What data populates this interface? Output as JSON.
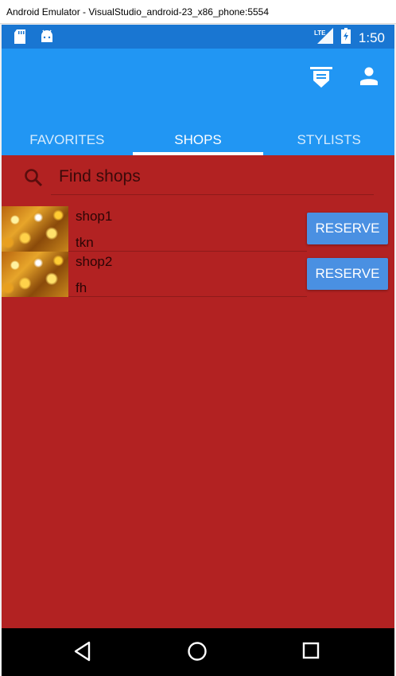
{
  "window": {
    "title": "Android Emulator - VisualStudio_android-23_x86_phone:5554"
  },
  "status_bar": {
    "time": "1:50",
    "network": "LTE",
    "left_icons": [
      "sd-card-icon",
      "android-icon"
    ],
    "right_icons": [
      "lte-signal-icon",
      "battery-icon"
    ],
    "color": "#1976d2"
  },
  "app_bar": {
    "actions": [
      "shop-sign-icon",
      "person-icon"
    ],
    "color": "#2196f3"
  },
  "tabs": [
    {
      "label": "FAVORITES",
      "active": false
    },
    {
      "label": "SHOPS",
      "active": true
    },
    {
      "label": "STYLISTS",
      "active": false
    }
  ],
  "search": {
    "placeholder": "Find shops",
    "icon": "search-icon"
  },
  "shops": [
    {
      "name": "shop1",
      "address": "tkn",
      "action": "RESERVE"
    },
    {
      "name": "shop2",
      "address": "fh",
      "action": "RESERVE"
    }
  ],
  "colors": {
    "background": "#b22222",
    "button": "#4a90e2"
  },
  "nav_bar": {
    "buttons": [
      "back-icon",
      "home-icon",
      "recents-icon"
    ]
  }
}
